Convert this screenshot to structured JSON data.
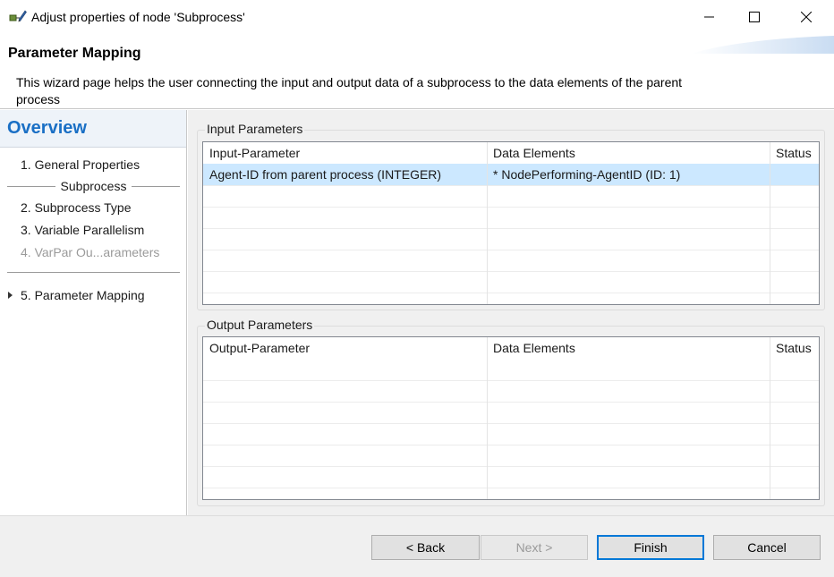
{
  "window": {
    "title": "Adjust properties of node 'Subprocess'"
  },
  "header": {
    "title": "Parameter Mapping",
    "description": "This wizard page helps the user connecting the input and output data of a subprocess to the data elements of the parent process"
  },
  "nav": {
    "overview_label": "Overview",
    "items": [
      {
        "label": "1.  General Properties",
        "enabled": true
      },
      {
        "label": "Subprocess",
        "group": true
      },
      {
        "label": "2.  Subprocess Type",
        "enabled": true
      },
      {
        "label": "3.  Variable Parallelism",
        "enabled": true
      },
      {
        "label": "4.  VarPar Ou...arameters",
        "enabled": false
      },
      {
        "label": "5.  Parameter Mapping",
        "enabled": true,
        "current": true
      }
    ]
  },
  "input_group": {
    "label": "Input Parameters",
    "columns": [
      "Input-Parameter",
      "Data Elements",
      "Status"
    ],
    "rows": [
      {
        "parameter": "Agent-ID from parent process  (INTEGER)",
        "data_element": "* NodePerforming-AgentID  (ID: 1)",
        "status": "",
        "selected": true
      }
    ]
  },
  "output_group": {
    "label": "Output Parameters",
    "columns": [
      "Output-Parameter",
      "Data Elements",
      "Status"
    ],
    "rows": []
  },
  "buttons": {
    "back": "< Back",
    "next": "Next >",
    "finish": "Finish",
    "cancel": "Cancel"
  },
  "colors": {
    "accent": "#1a6fc5",
    "selection": "#cce8ff",
    "default_button_border": "#0078d7"
  },
  "icons": {
    "app": "node-wizard-icon",
    "minimize": "minimize-icon",
    "maximize": "maximize-icon",
    "close": "close-icon",
    "current_step": "triangle-right-icon"
  }
}
